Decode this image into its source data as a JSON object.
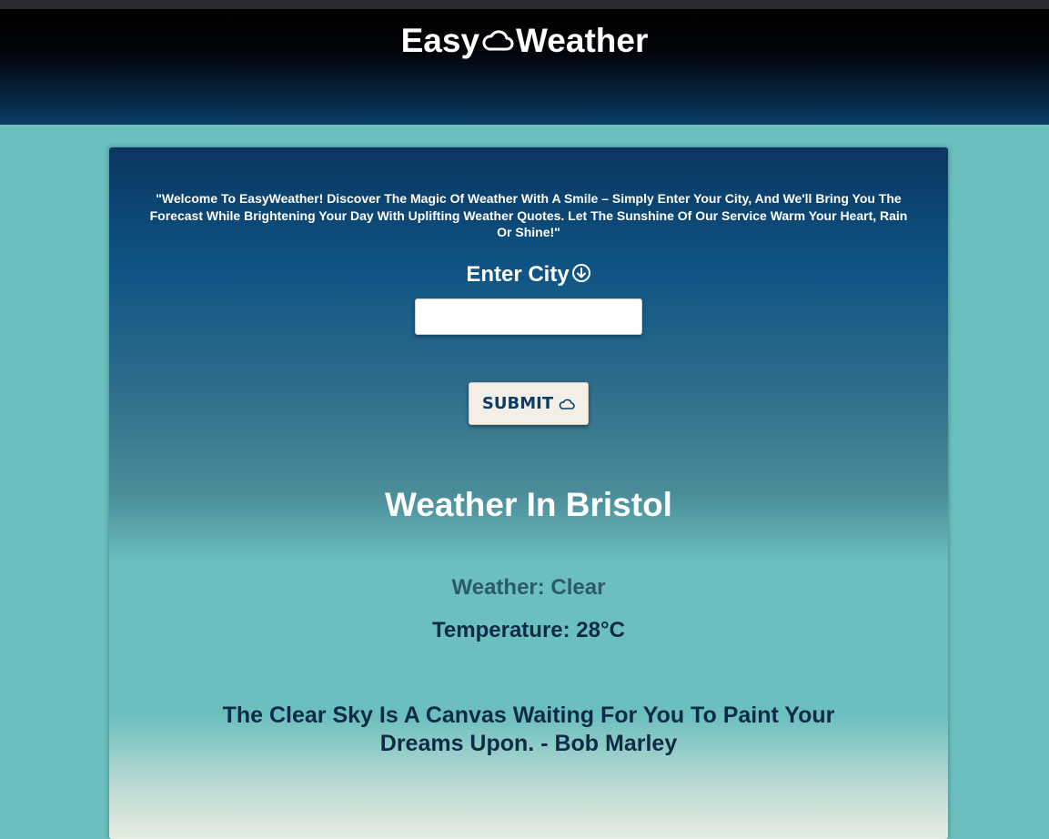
{
  "header": {
    "logo_left": "Easy",
    "logo_right": "Weather",
    "logo_icon": "cloud-icon"
  },
  "intro": {
    "text": "\"Welcome To EasyWeather! Discover The Magic Of Weather With A Smile – Simply Enter Your City, And We'll Bring You The Forecast While Brightening Your Day With Uplifting Weather Quotes. Let The Sunshine Of Our Service Warm Your Heart, Rain Or Shine!\""
  },
  "form": {
    "city_label": "Enter City",
    "city_label_icon": "arrow-down-circle-icon",
    "city_value": "",
    "submit_label": "SUBMIT",
    "submit_icon": "cloud-icon"
  },
  "result": {
    "title": "Weather In Bristol",
    "weather": "Weather: Clear",
    "temperature": "Temperature: 28°C",
    "quote": "The Clear Sky Is A Canvas Waiting For You To Paint Your Dreams Upon. - Bob Marley"
  },
  "colors": {
    "page_bg": "#6bbfbe",
    "header_dark": "#000000",
    "header_blue": "#0b3d67",
    "button_bg": "#f3efe6",
    "button_text": "#0b3d67"
  }
}
